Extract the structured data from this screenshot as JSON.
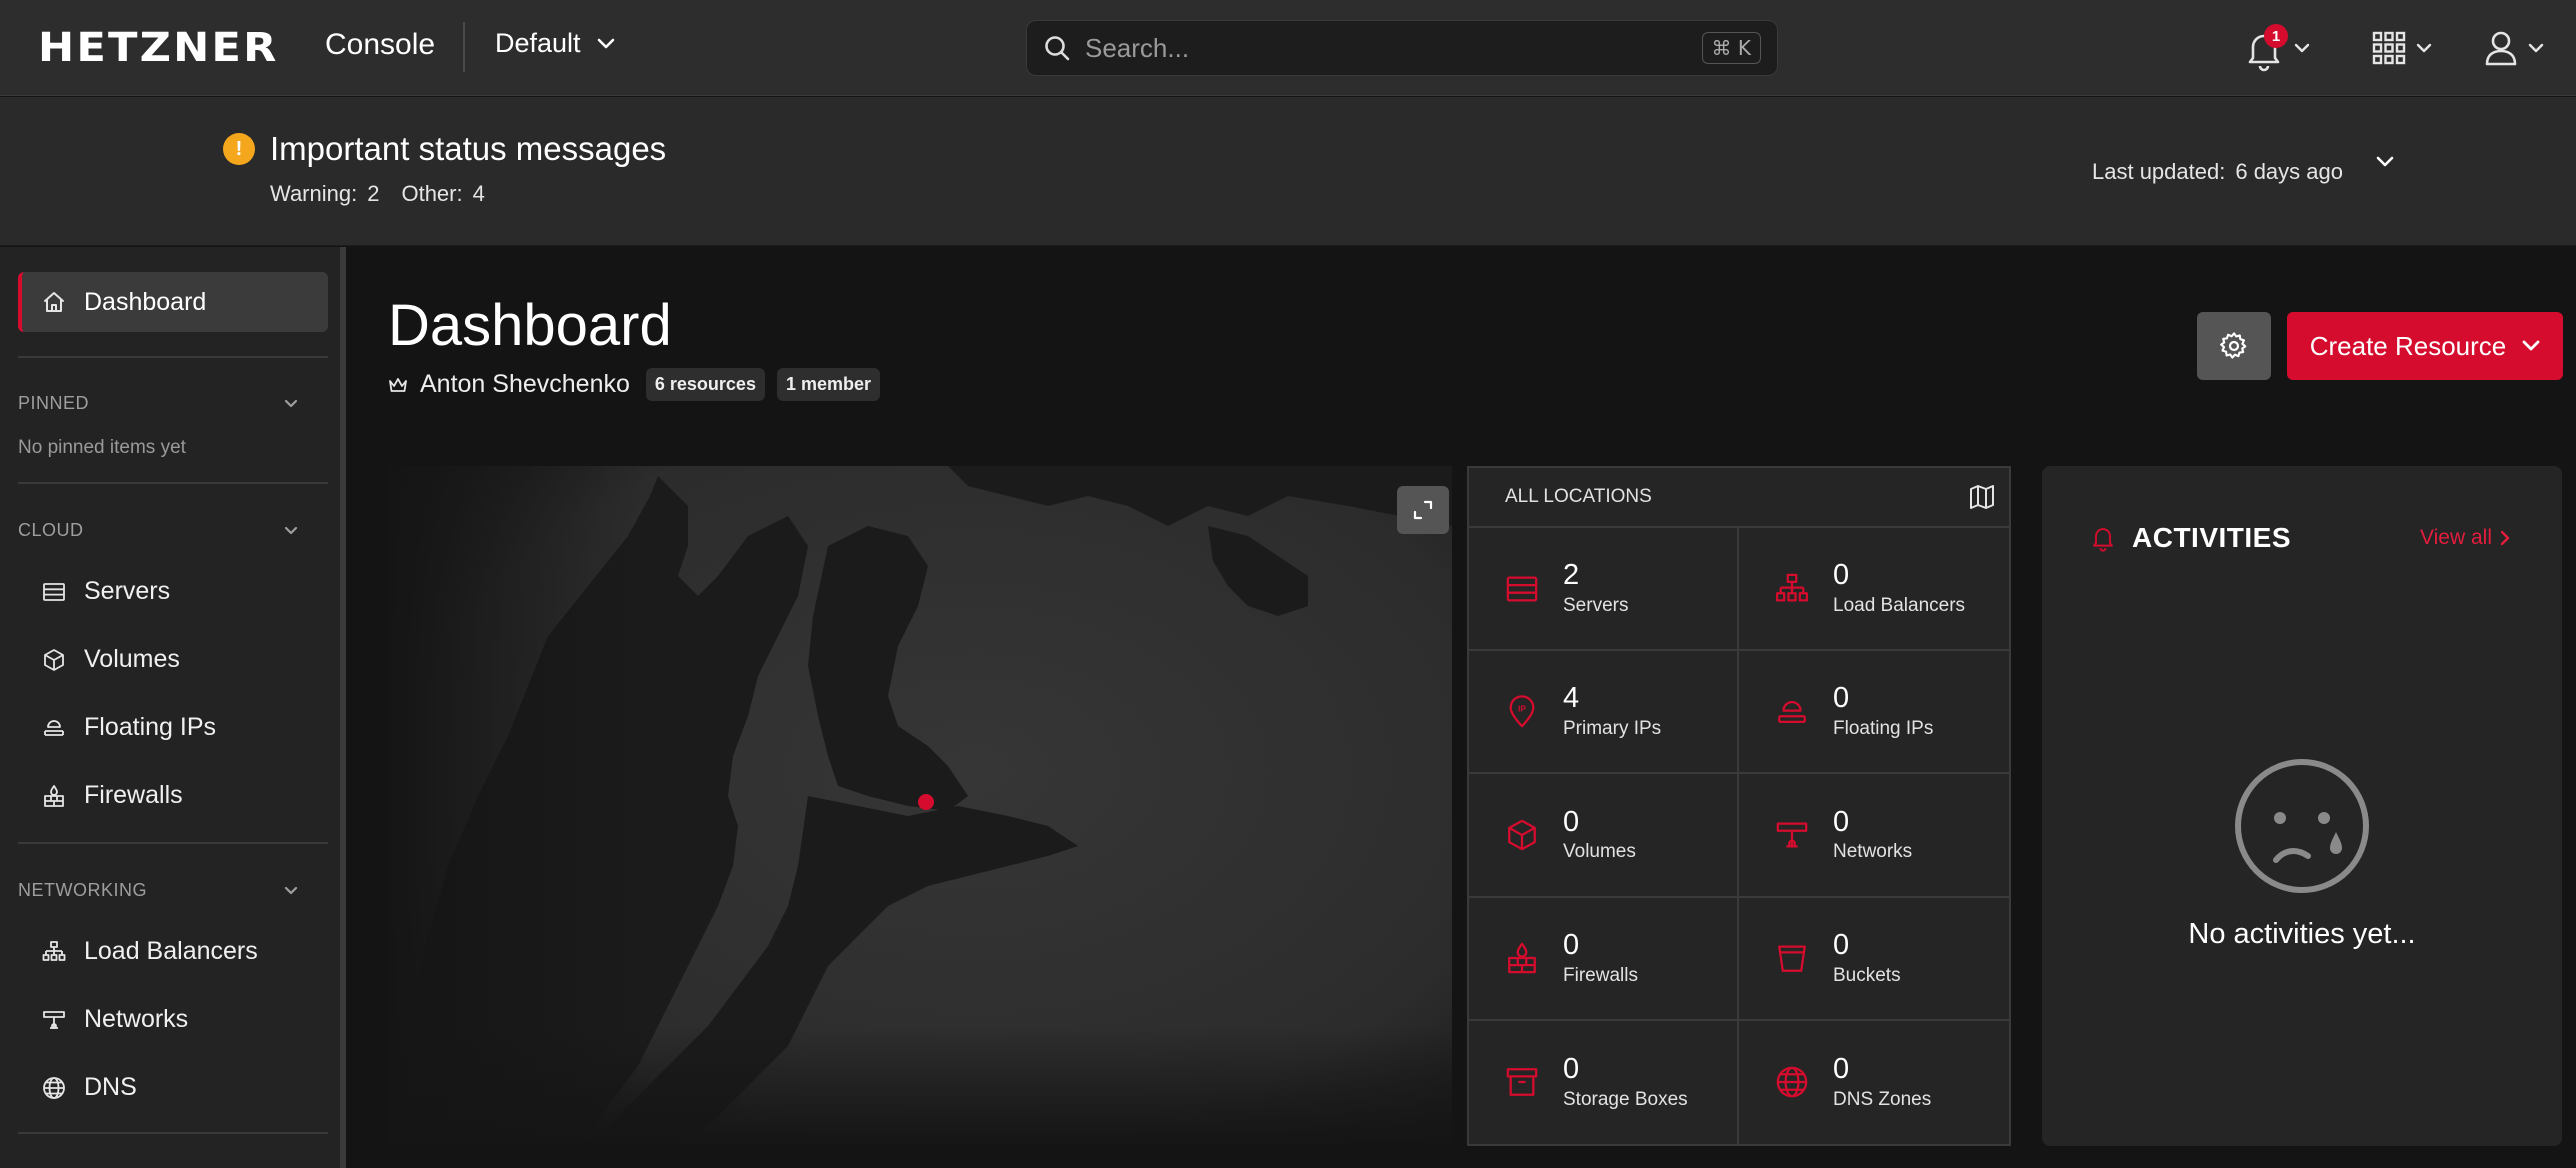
{
  "header": {
    "logo": "HETZNER",
    "product": "Console",
    "project": "Default",
    "search_placeholder": "Search...",
    "search_shortcut": "⌘ K",
    "notification_count": "1"
  },
  "status": {
    "title": "Important status messages",
    "warning_label": "Warning:",
    "warning_count": "2",
    "other_label": "Other:",
    "other_count": "4",
    "last_updated_label": "Last updated:",
    "last_updated_value": "6 days ago"
  },
  "sidebar": {
    "dashboard": "Dashboard",
    "pinned_label": "PINNED",
    "pinned_empty": "No pinned items yet",
    "cloud_label": "CLOUD",
    "cloud_items": [
      "Servers",
      "Volumes",
      "Floating IPs",
      "Firewalls"
    ],
    "networking_label": "NETWORKING",
    "networking_items": [
      "Load Balancers",
      "Networks",
      "DNS"
    ]
  },
  "main": {
    "title": "Dashboard",
    "owner": "Anton Shevchenko",
    "resources_chip": "6 resources",
    "members_chip": "1 member",
    "create_button": "Create Resource"
  },
  "locations": {
    "header": "ALL LOCATIONS",
    "resources": [
      {
        "count": "2",
        "label": "Servers",
        "icon": "server-icon"
      },
      {
        "count": "0",
        "label": "Load Balancers",
        "icon": "load-balancer-icon"
      },
      {
        "count": "4",
        "label": "Primary IPs",
        "icon": "primary-ip-icon"
      },
      {
        "count": "0",
        "label": "Floating IPs",
        "icon": "floating-ip-icon"
      },
      {
        "count": "0",
        "label": "Volumes",
        "icon": "volume-icon"
      },
      {
        "count": "0",
        "label": "Networks",
        "icon": "network-icon"
      },
      {
        "count": "0",
        "label": "Firewalls",
        "icon": "firewall-icon"
      },
      {
        "count": "0",
        "label": "Buckets",
        "icon": "bucket-icon"
      },
      {
        "count": "0",
        "label": "Storage Boxes",
        "icon": "storage-box-icon"
      },
      {
        "count": "0",
        "label": "DNS Zones",
        "icon": "dns-zone-icon"
      }
    ]
  },
  "activities": {
    "title": "ACTIVITIES",
    "view_all": "View all",
    "empty": "No activities yet..."
  },
  "colors": {
    "accent": "#d50c2d",
    "warning": "#f4a71d",
    "topbar": "#2d2d2d",
    "background": "#141414"
  }
}
